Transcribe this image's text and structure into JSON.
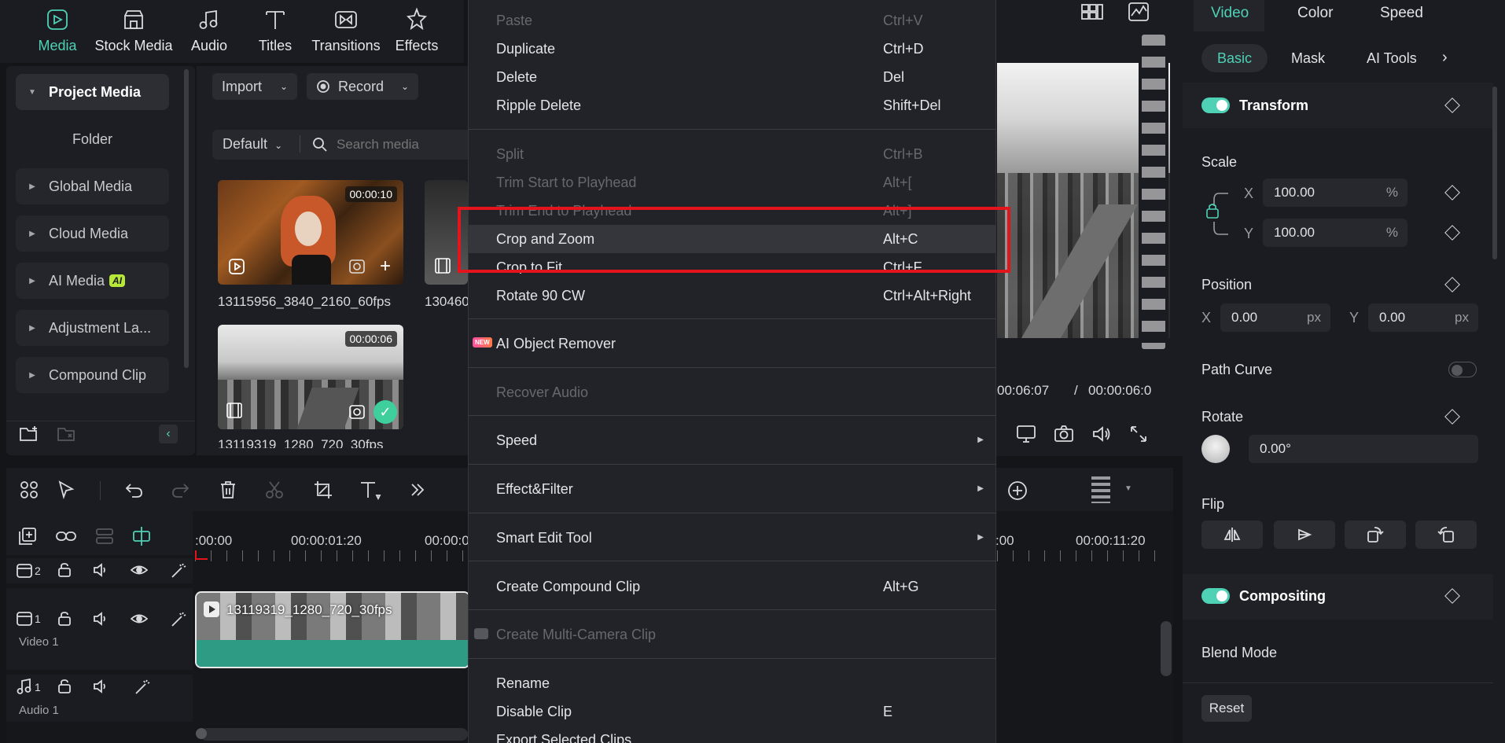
{
  "top_tabs": [
    {
      "label": "Media",
      "icon": "media-icon",
      "active": true
    },
    {
      "label": "Stock Media",
      "icon": "stock-media-icon"
    },
    {
      "label": "Audio",
      "icon": "audio-icon"
    },
    {
      "label": "Titles",
      "icon": "titles-icon"
    },
    {
      "label": "Transitions",
      "icon": "transitions-icon"
    },
    {
      "label": "Effects",
      "icon": "effects-icon"
    }
  ],
  "left_nav": {
    "project_media": "Project Media",
    "folder": "Folder",
    "items": [
      "Global Media",
      "Cloud Media",
      "AI Media",
      "Adjustment La...",
      "Compound Clip"
    ],
    "ai_badge": "AI"
  },
  "media": {
    "import_label": "Import",
    "record_label": "Record",
    "sort_label": "Default",
    "search_placeholder": "Search media",
    "thumbs": [
      {
        "name": "13115956_3840_2160_60fps",
        "duration": "00:00:10"
      },
      {
        "name": "130460",
        "duration": ""
      },
      {
        "name": "13119319_1280_720_30fps",
        "duration": "00:00:06"
      }
    ]
  },
  "timeline": {
    "ruler": [
      ":00:00",
      "00:00:01:20",
      "00:00:0",
      ":00",
      "00:00:11:20"
    ],
    "tracks": [
      {
        "num": "2",
        "name": ""
      },
      {
        "num": "1",
        "name": "Video 1"
      },
      {
        "num": "1",
        "name": "Audio 1"
      }
    ],
    "clip_name": "13119319_1280_720_30fps"
  },
  "preview": {
    "current_time": "00:06:07",
    "separator": "/",
    "total_time": "00:00:06:0"
  },
  "context_menu": {
    "items": [
      {
        "label": "Paste",
        "shortcut": "Ctrl+V",
        "disabled": true
      },
      {
        "label": "Duplicate",
        "shortcut": "Ctrl+D"
      },
      {
        "label": "Delete",
        "shortcut": "Del"
      },
      {
        "label": "Ripple Delete",
        "shortcut": "Shift+Del"
      },
      {
        "label": "Split",
        "shortcut": "Ctrl+B",
        "disabled": true
      },
      {
        "label": "Trim Start to Playhead",
        "shortcut": "Alt+[",
        "disabled": true
      },
      {
        "label": "Trim End to Playhead",
        "shortcut": "Alt+]",
        "disabled": true
      },
      {
        "label": "Crop and Zoom",
        "shortcut": "Alt+C",
        "highlighted": true
      },
      {
        "label": "Crop to Fit",
        "shortcut": "Ctrl+F"
      },
      {
        "label": "Rotate 90 CW",
        "shortcut": "Ctrl+Alt+Right"
      },
      {
        "label": "AI Object Remover",
        "shortcut": "",
        "badge": "NEW"
      },
      {
        "label": "Recover Audio",
        "shortcut": "",
        "disabled": true
      },
      {
        "label": "Speed",
        "shortcut": "",
        "submenu": true
      },
      {
        "label": "Effect&Filter",
        "shortcut": "",
        "submenu": true
      },
      {
        "label": "Smart Edit Tool",
        "shortcut": "",
        "submenu": true
      },
      {
        "label": "Create Compound Clip",
        "shortcut": "Alt+G"
      },
      {
        "label": "Create Multi-Camera Clip",
        "shortcut": "",
        "disabled": true
      },
      {
        "label": "Rename",
        "shortcut": ""
      },
      {
        "label": "Disable Clip",
        "shortcut": "E"
      },
      {
        "label": "Export Selected Clips",
        "shortcut": ""
      }
    ]
  },
  "right_panel": {
    "tabs": [
      "Video",
      "Color",
      "Speed"
    ],
    "sub_tabs": [
      "Basic",
      "Mask",
      "AI Tools"
    ],
    "transform": "Transform",
    "scale": "Scale",
    "x_label": "X",
    "y_label": "Y",
    "scale_x": "100.00",
    "scale_y": "100.00",
    "percent": "%",
    "position": "Position",
    "pos_x": "0.00",
    "pos_y": "0.00",
    "px": "px",
    "path_curve": "Path Curve",
    "rotate": "Rotate",
    "rotate_value": "0.00°",
    "flip": "Flip",
    "compositing": "Compositing",
    "blend_mode": "Blend Mode",
    "reset": "Reset"
  },
  "colors": {
    "accent": "#4fd1b5",
    "highlight_box": "#e3141b",
    "menu_bg": "#222328"
  }
}
